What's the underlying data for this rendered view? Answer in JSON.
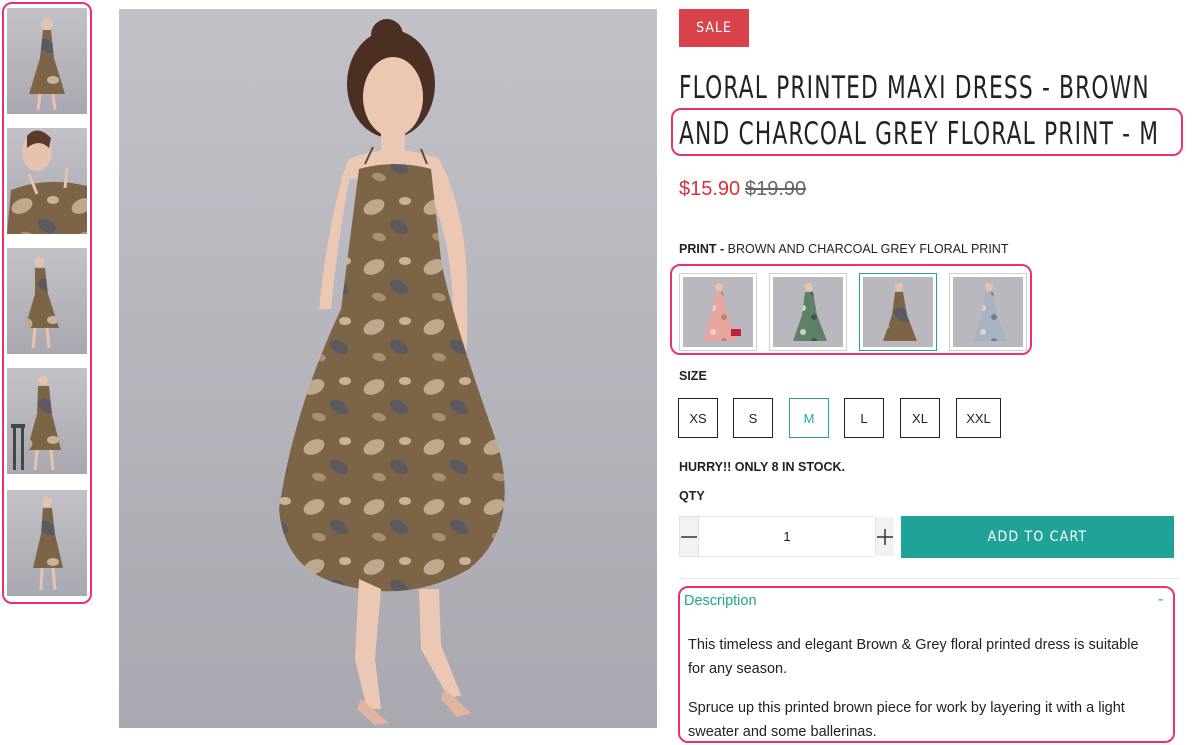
{
  "badge": {
    "sale": "SALE"
  },
  "product": {
    "title_line1": "FLORAL PRINTED MAXI DRESS - BROWN",
    "title_line2": "AND CHARCOAL GREY FLORAL PRINT - M",
    "price": "$15.90",
    "compare_price": "$19.90"
  },
  "print_option": {
    "label": "PRINT -",
    "value": "BROWN AND CHARCOAL GREY FLORAL PRINT"
  },
  "size_option": {
    "label": "SIZE",
    "sizes": [
      "XS",
      "S",
      "M",
      "L",
      "XL",
      "XXL"
    ],
    "selected": "M"
  },
  "stock": {
    "text": "HURRY!! ONLY 8 IN STOCK."
  },
  "quantity": {
    "label": "QTY",
    "value": "1"
  },
  "cart": {
    "add_label": "ADD TO CART"
  },
  "description": {
    "toggle_label": "Description",
    "collapse_symbol": "-",
    "paragraph1": "This timeless and elegant Brown & Grey floral printed dress is suitable for any season.",
    "paragraph2": "Spruce up this printed brown piece for work by layering it with a light sweater and some ballerinas."
  },
  "colors": {
    "accent": "#1fa398",
    "sale": "#d9434b",
    "price": "#d9303a",
    "highlight": "#e8336f"
  },
  "icons": {
    "minus": "minus-icon",
    "plus": "plus-icon"
  }
}
